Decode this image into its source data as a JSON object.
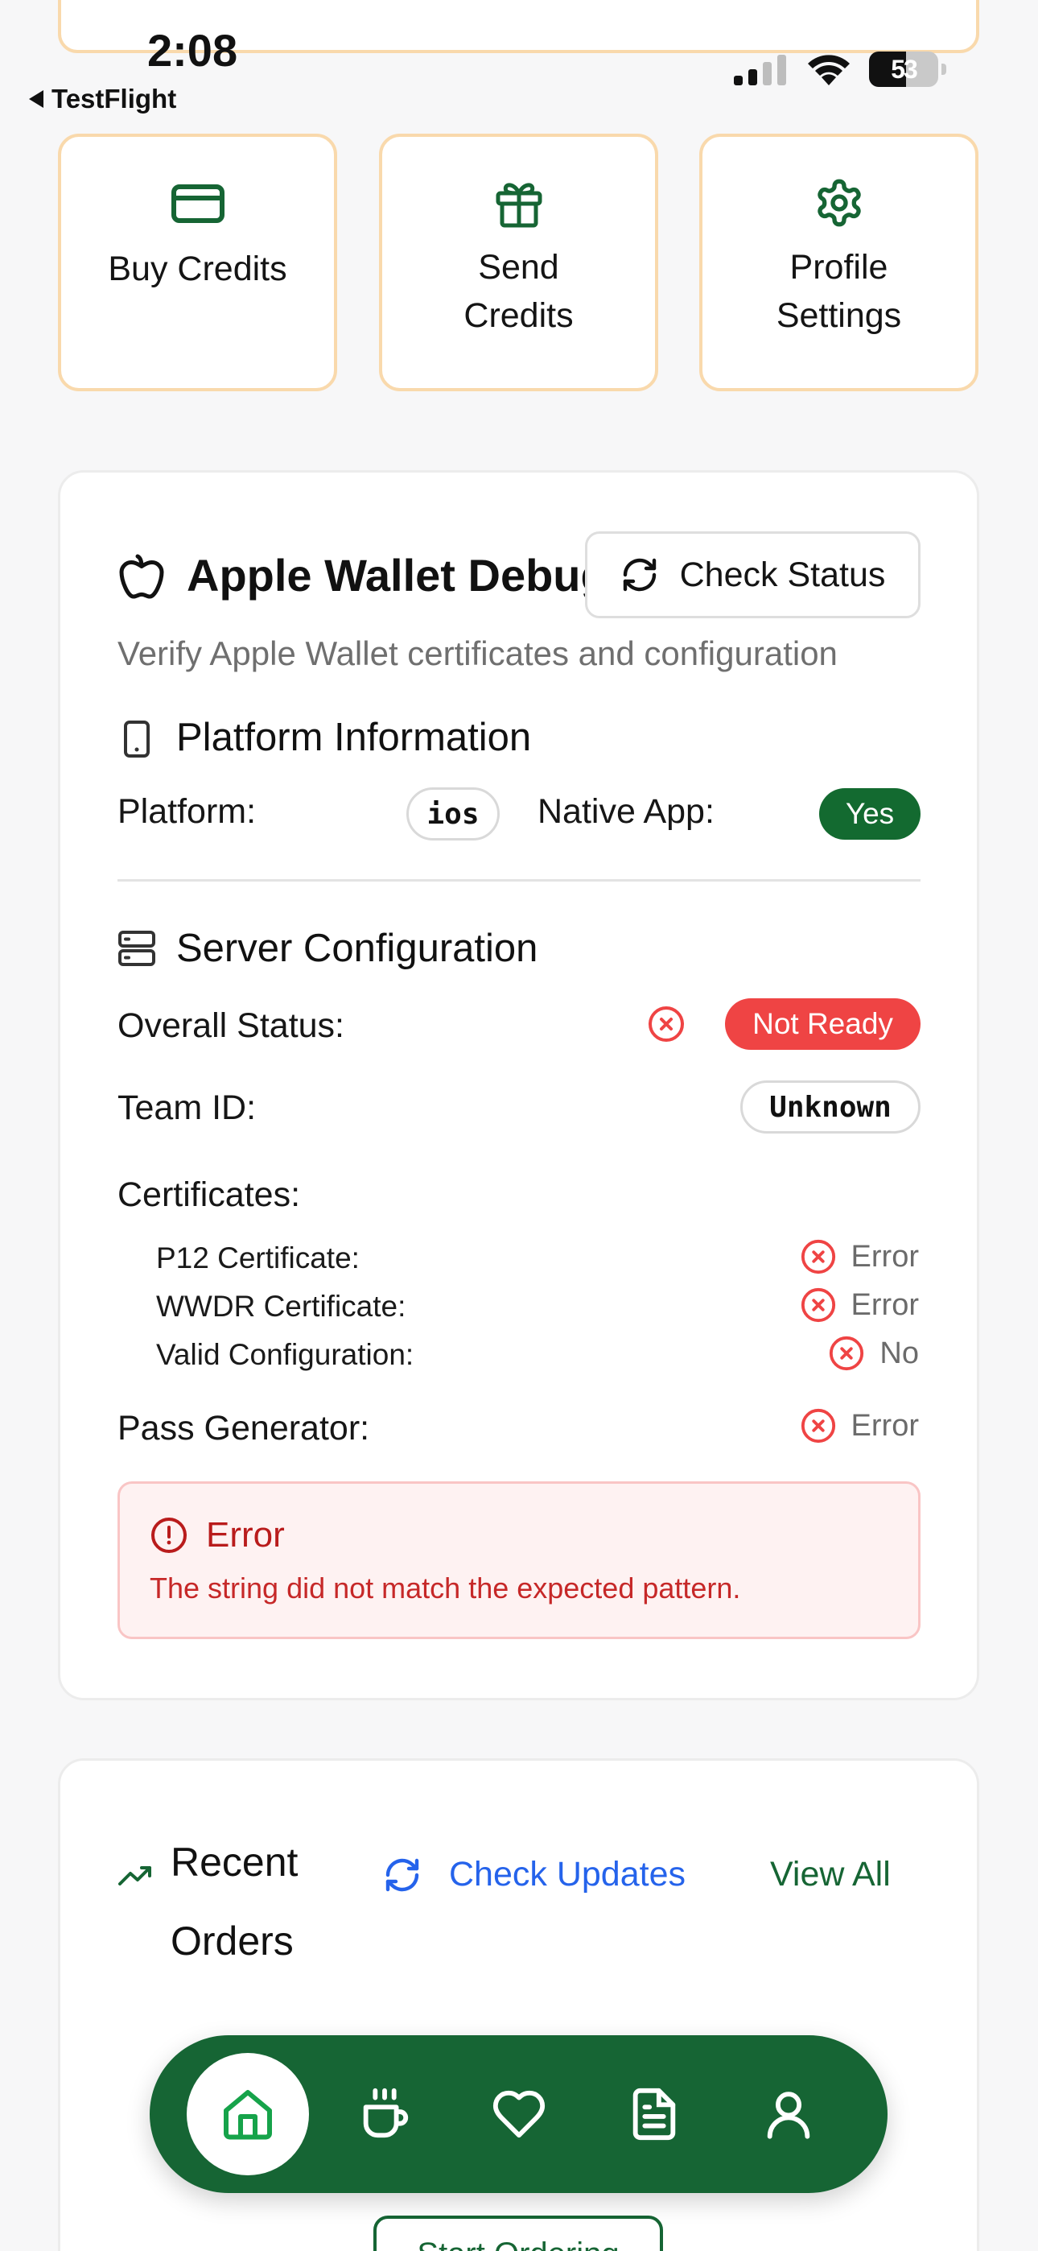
{
  "status_bar": {
    "time": "2:08",
    "back_app": "TestFlight",
    "battery": "53"
  },
  "quick_actions": [
    {
      "label": "Buy Credits",
      "icon": "credit-card-icon"
    },
    {
      "label": "Send Credits",
      "icon": "gift-icon"
    },
    {
      "label": "Profile Settings",
      "icon": "gear-icon"
    }
  ],
  "debug": {
    "title": "Apple Wallet Debug",
    "check_status": "Check Status",
    "subtitle": "Verify Apple Wallet certificates and configuration",
    "platform_section": "Platform Information",
    "platform_label": "Platform:",
    "platform_value": "ios",
    "native_label": "Native App:",
    "native_value": "Yes",
    "server_section": "Server Configuration",
    "overall_label": "Overall Status:",
    "overall_value": "Not Ready",
    "team_label": "Team ID:",
    "team_value": "Unknown",
    "certs_label": "Certificates:",
    "certs": [
      {
        "label": "P12 Certificate:",
        "status": "Error"
      },
      {
        "label": "WWDR Certificate:",
        "status": "Error"
      },
      {
        "label": "Valid Configuration:",
        "status": "No"
      }
    ],
    "pass_label": "Pass Generator:",
    "pass_status": "Error",
    "error_title": "Error",
    "error_message": "The string did not match the expected pattern."
  },
  "orders": {
    "title_line1": "Recent",
    "title_line2": "Orders",
    "check_updates": "Check Updates",
    "view_all": "View All",
    "start_button": "Start Ordering"
  },
  "colors": {
    "brand_green": "#166534",
    "accent_orange_border": "#f9d9ac",
    "error_red": "#ef4444",
    "link_blue": "#2563eb"
  }
}
